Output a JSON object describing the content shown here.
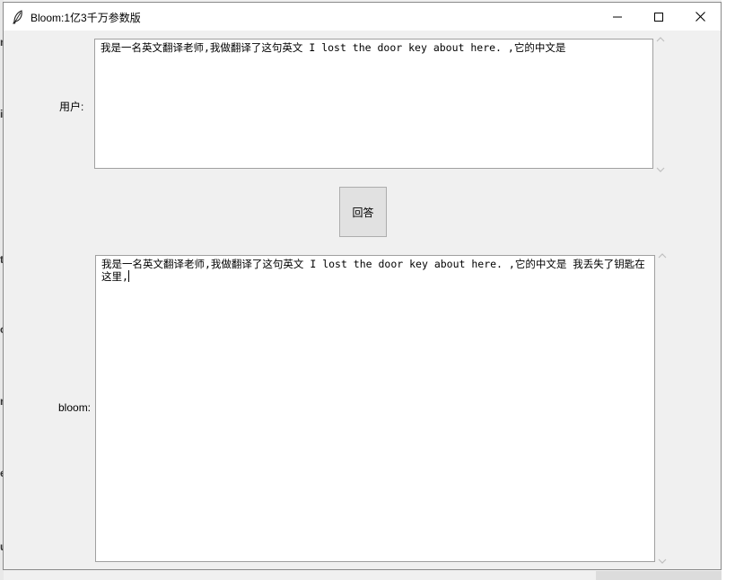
{
  "window": {
    "title": "Bloom:1亿3千万参数版"
  },
  "user_input": {
    "label": "用户:",
    "value": "我是一名英文翻译老师,我做翻译了这句英文 I lost the door key about here. ,它的中文是"
  },
  "answer_button": {
    "label": "回答"
  },
  "bloom_output": {
    "label": "bloom:",
    "value": "我是一名英文翻译老师,我做翻译了这句英文 I lost the door key about here. ,它的中文是 我丢失了钥匙在这里,"
  },
  "icons": {
    "app": "feather-icon",
    "minimize": "minimize-icon",
    "maximize": "maximize-icon",
    "close": "close-icon",
    "scroll_up": "chevron-up-icon",
    "scroll_down": "chevron-down-icon"
  }
}
